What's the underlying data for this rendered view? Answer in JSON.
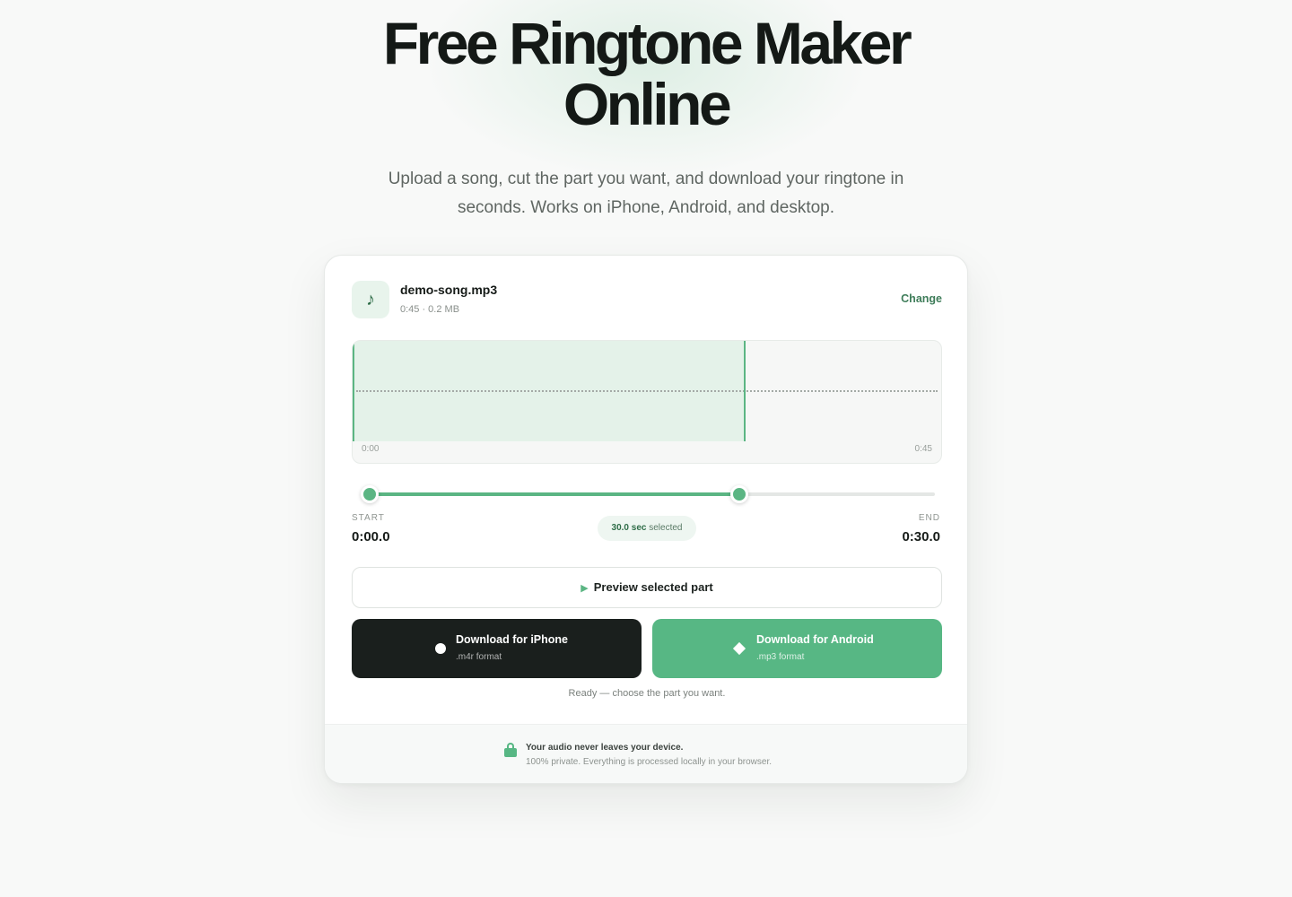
{
  "hero": {
    "title": "Free Ringtone Maker Online",
    "title_line1": "Free Ringtone Maker",
    "title_line2": "Online",
    "subtitle": "Upload a song, cut the part you want, and download your ringtone in seconds. Works on iPhone, Android, and desktop."
  },
  "file": {
    "icon": "music-note-icon",
    "icon_glyph": "♪",
    "name": "demo-song.mp3",
    "meta": "0:45 · 0.2 MB",
    "change_label": "Change"
  },
  "waveform": {
    "start_time": "0:00",
    "end_time": "0:45",
    "selection_fraction": 0.667
  },
  "range": {
    "start_label": "START",
    "start_value": "0:00.0",
    "end_label": "END",
    "end_value": "0:30.0",
    "selected_bold": "30.0 sec",
    "selected_suffix": " selected"
  },
  "actions": {
    "preview_icon": "▶",
    "preview_label": "Preview selected part",
    "iphone_title": "Download for iPhone",
    "iphone_format": ".m4r format",
    "android_title": "Download for Android",
    "android_format": ".mp3 format",
    "status": "Ready — choose the part you want."
  },
  "privacy": {
    "icon": "lock-icon",
    "headline": "Your audio never leaves your device.",
    "detail": "100% private. Everything is processed locally in your browser."
  },
  "colors": {
    "accent": "#57b784",
    "dark_button": "#1a1f1d",
    "background": "#f8f9f8"
  }
}
